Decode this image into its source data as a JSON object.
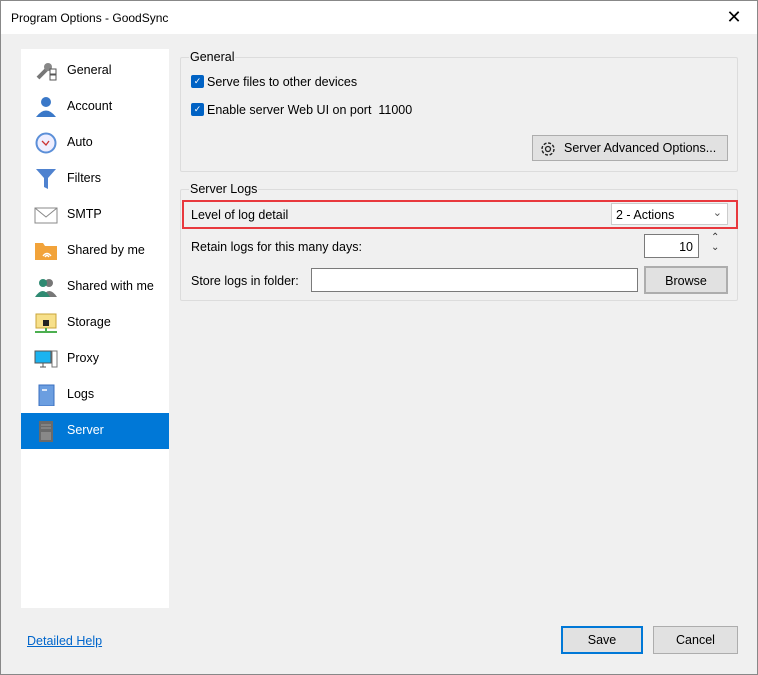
{
  "window": {
    "title": "Program Options - GoodSync",
    "close": "✕"
  },
  "sidebar": {
    "items": [
      {
        "label": "General",
        "icon": "wrench-checklist-icon"
      },
      {
        "label": "Account",
        "icon": "user-icon"
      },
      {
        "label": "Auto",
        "icon": "clock-icon"
      },
      {
        "label": "Filters",
        "icon": "funnel-icon"
      },
      {
        "label": "SMTP",
        "icon": "envelope-icon"
      },
      {
        "label": "Shared by me",
        "icon": "shared-folder-icon"
      },
      {
        "label": "Shared with me",
        "icon": "users-icon"
      },
      {
        "label": "Storage",
        "icon": "storage-lock-icon"
      },
      {
        "label": "Proxy",
        "icon": "computer-icon"
      },
      {
        "label": "Logs",
        "icon": "log-book-icon"
      },
      {
        "label": "Server",
        "icon": "server-icon"
      }
    ],
    "selected": "Server"
  },
  "general": {
    "title": "General",
    "serve_files": {
      "label": "Serve files to other devices",
      "checked": true
    },
    "web_ui": {
      "label": "Enable server Web UI on port  11000",
      "checked": true
    },
    "advanced_button": "Server Advanced Options..."
  },
  "logs": {
    "title": "Server Logs",
    "level_label": "Level of log detail",
    "level_value": "2 - Actions",
    "retain_label": "Retain logs for this many days:",
    "retain_value": "10",
    "folder_label": "Store logs in folder:",
    "folder_value": "",
    "browse": "Browse"
  },
  "footer": {
    "help": "Detailed Help",
    "save": "Save",
    "cancel": "Cancel"
  },
  "colors": {
    "accent": "#0078d7",
    "highlight": "#e8383d"
  }
}
